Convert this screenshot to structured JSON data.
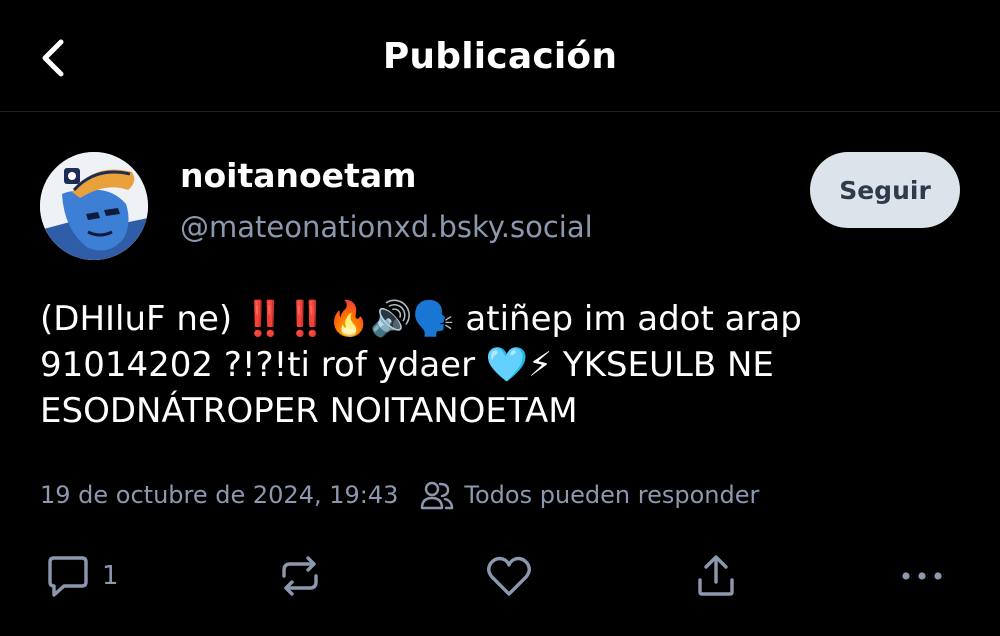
{
  "header": {
    "title": "Publicación",
    "back_icon": "chevron-left-icon"
  },
  "author": {
    "display_name": "noitanoetam",
    "handle": "@mateonationxd.bsky.social",
    "follow_label": "Seguir"
  },
  "post": {
    "text": "(DHIluF ne) ‼️‼️🔥🔊🗣️ atiñep im adot arap\n91014202 ?!?!ti rof ydaer 🩵⚡ YKSEULB NE\nESODNÁTROPER NOITANOETAM",
    "timestamp": "19 de octubre de 2024, 19:43",
    "reply_setting": "Todos pueden responder"
  },
  "actions": {
    "reply_count": "1",
    "icons": [
      "reply-icon",
      "repost-icon",
      "like-icon",
      "share-icon",
      "more-icon"
    ]
  },
  "colors": {
    "background": "#000000",
    "muted_text": "#8b98ad",
    "follow_bg": "#dde3ea",
    "divider": "#1c2129"
  }
}
